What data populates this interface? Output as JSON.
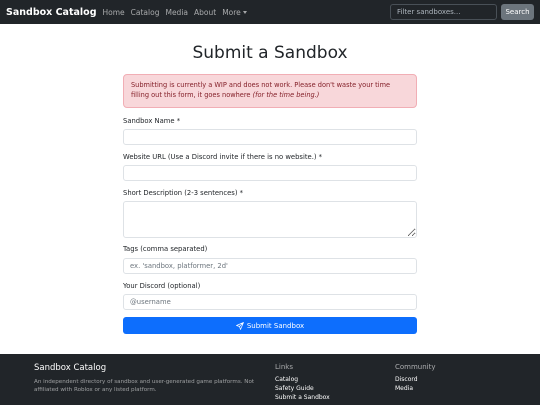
{
  "navbar": {
    "brand": "Sandbox Catalog",
    "links": [
      "Home",
      "Catalog",
      "Media",
      "About"
    ],
    "more_label": "More",
    "search_placeholder": "Filter sandboxes...",
    "search_button": "Search"
  },
  "main": {
    "title": "Submit a Sandbox",
    "alert_text": "Submitting is currently a WIP and does not work. Please don't waste your time filling out this form, it goes nowhere ",
    "alert_emphasis": "(for the time being.)",
    "fields": {
      "name_label": "Sandbox Name *",
      "url_label": "Website URL (Use a Discord invite if there is no website.) *",
      "desc_label": "Short Description (2-3 sentences) *",
      "tags_label": "Tags (comma separated)",
      "tags_placeholder": "ex. 'sandbox, platformer, 2d'",
      "discord_label": "Your Discord (optional)",
      "discord_placeholder": "@username"
    },
    "submit_label": "Submit Sandbox"
  },
  "footer": {
    "title": "Sandbox Catalog",
    "description": "An independent directory of sandbox and user-generated game platforms. Not affiliated with Roblox or any listed platform.",
    "links_heading": "Links",
    "links": [
      "Catalog",
      "Safety Guide",
      "Submit a Sandbox"
    ],
    "community_heading": "Community",
    "community": [
      "Discord",
      "Media"
    ]
  },
  "colors": {
    "navbar_bg": "#212529",
    "primary": "#0d6efd",
    "alert_bg": "#f8d7da",
    "alert_text": "#842029"
  }
}
